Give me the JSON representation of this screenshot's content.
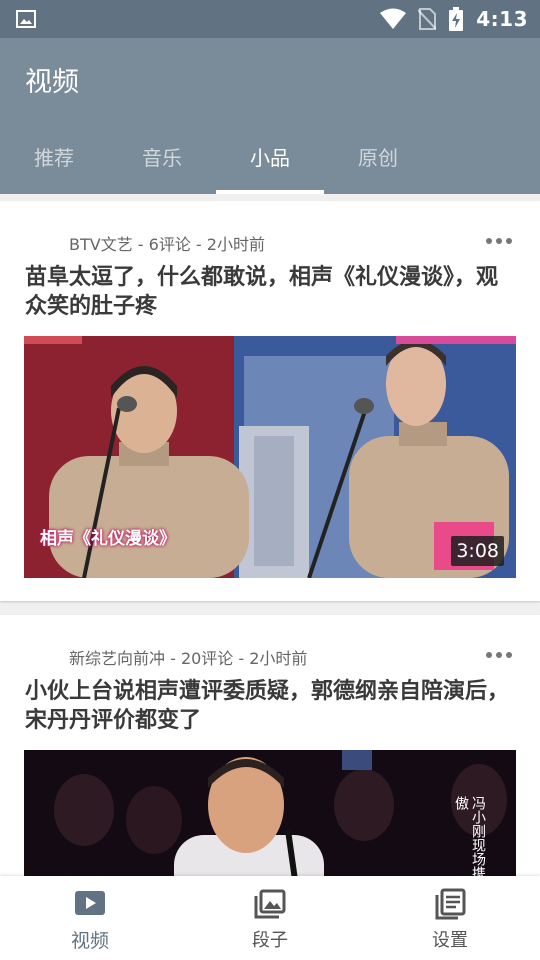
{
  "status_bar": {
    "time": "4:13"
  },
  "app_bar": {
    "title": "视频"
  },
  "tabs": [
    {
      "label": "推荐",
      "active": false
    },
    {
      "label": "音乐",
      "active": false
    },
    {
      "label": "小品",
      "active": true
    },
    {
      "label": "原创",
      "active": false
    }
  ],
  "feed": [
    {
      "meta": "BTV文艺 - 6评论 - 2小时前",
      "title": "苗阜太逗了，什么都敢说，相声《礼仪漫谈》，观众笑的肚子疼",
      "duration": "3:08",
      "caption": "相声《礼仪漫谈》"
    },
    {
      "meta": "新综艺向前冲 - 20评论 - 2小时前",
      "title": "小伙上台说相声遭评委质疑，郭德纲亲自陪演后，宋丹丹评价都变了",
      "side_text": "冯小刚现场携爱徒笑傲"
    }
  ],
  "bottom_nav": [
    {
      "label": "视频",
      "icon": "video-icon",
      "active": true
    },
    {
      "label": "段子",
      "icon": "image-icon",
      "active": false
    },
    {
      "label": "设置",
      "icon": "settings-icon",
      "active": false
    }
  ],
  "colors": {
    "status_bar": "#617382",
    "app_bar": "#7a8b99",
    "accent": "#617382"
  }
}
